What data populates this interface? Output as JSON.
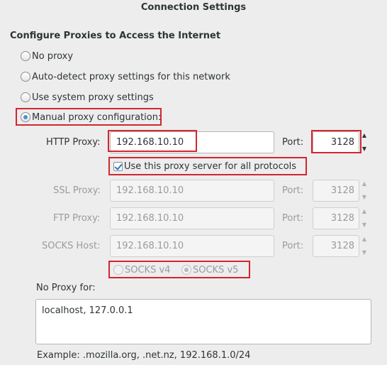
{
  "window": {
    "title": "Connection Settings"
  },
  "section_title": "Configure Proxies to Access the Internet",
  "proxy_options": [
    {
      "label": "No proxy",
      "checked": false
    },
    {
      "label": "Auto-detect proxy settings for this network",
      "checked": false
    },
    {
      "label": "Use system proxy settings",
      "checked": false
    },
    {
      "label": "Manual proxy configuration:",
      "checked": true
    }
  ],
  "http": {
    "label": "HTTP Proxy:",
    "value": "192.168.10.10",
    "port_label": "Port:",
    "port": "3128"
  },
  "use_for_all": {
    "label": "Use this proxy server for all protocols",
    "checked": true
  },
  "ssl": {
    "label": "SSL Proxy:",
    "value": "192.168.10.10",
    "port_label": "Port:",
    "port": "3128"
  },
  "ftp": {
    "label": "FTP Proxy:",
    "value": "192.168.10.10",
    "port_label": "Port:",
    "port": "3128"
  },
  "socks": {
    "label": "SOCKS Host:",
    "value": "192.168.10.10",
    "port_label": "Port:",
    "port": "3128"
  },
  "socks_versions": [
    {
      "label": "SOCKS v4",
      "checked": false
    },
    {
      "label": "SOCKS v5",
      "checked": true
    }
  ],
  "no_proxy": {
    "label": "No Proxy for:",
    "value": "localhost, 127.0.0.1",
    "example": "Example: .mozilla.org, .net.nz, 192.168.1.0/24"
  },
  "colors": {
    "highlight": "#d22630",
    "accent": "#4a90d9"
  },
  "icons": {
    "spin_up": "chevron-up-icon",
    "spin_down": "chevron-down-icon",
    "check": "checkmark-icon"
  }
}
